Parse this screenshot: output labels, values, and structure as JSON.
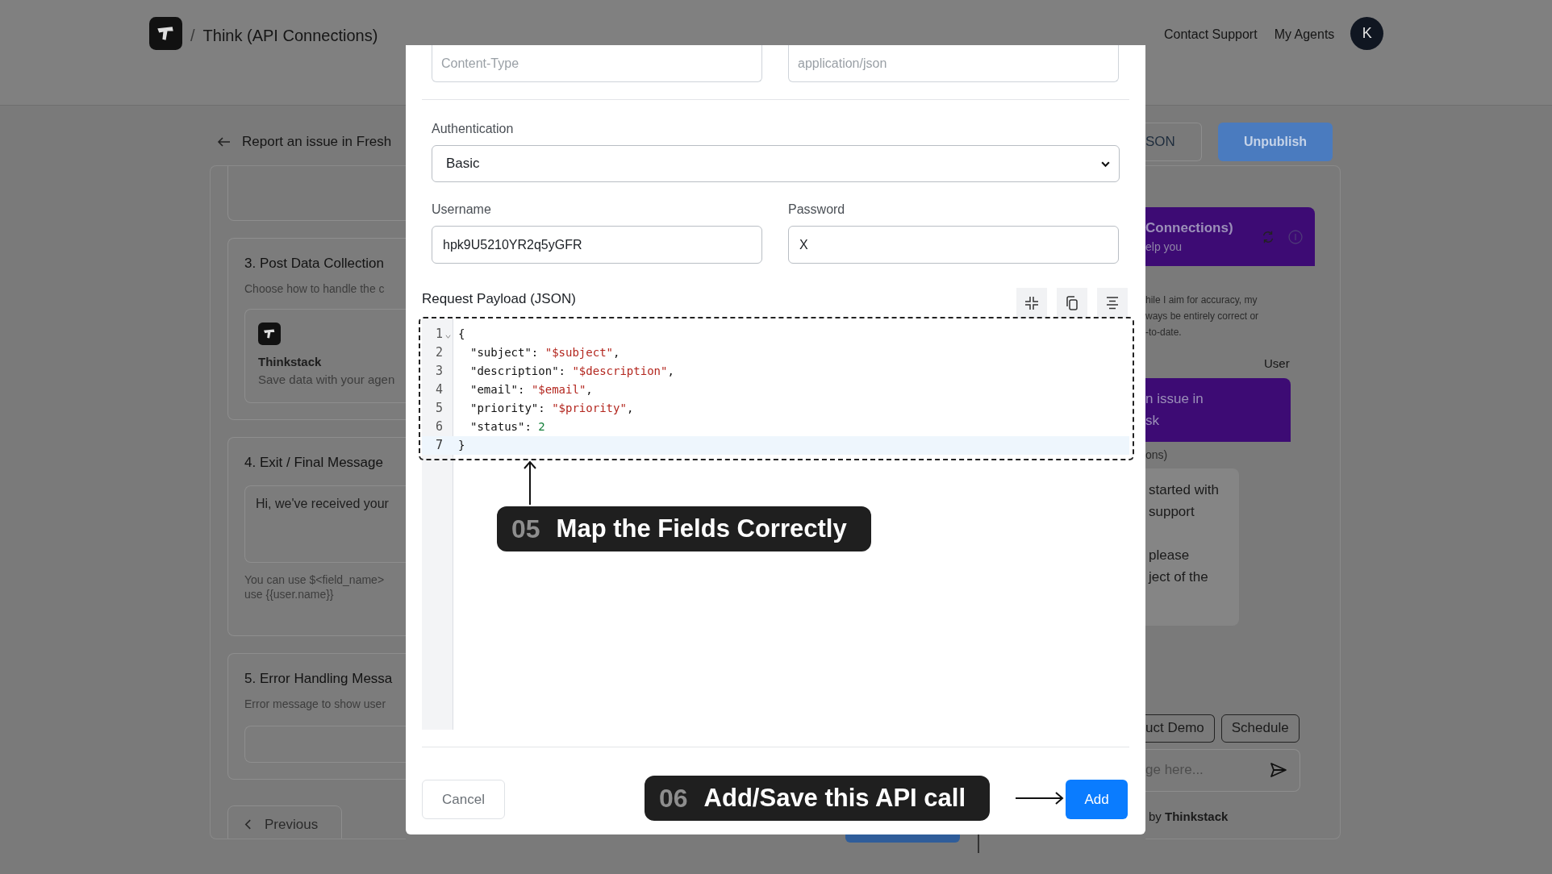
{
  "header": {
    "separator": "/",
    "title": "Think (API Connections)",
    "links": [
      "Contact Support",
      "My Agents"
    ],
    "avatar": "K"
  },
  "page": {
    "back_title": "Report an issue in Fresh",
    "buttons": [
      "SON",
      "Unpublish"
    ]
  },
  "steps": [
    {
      "kind": "options",
      "title": "3. Post Data Collection",
      "description": "Choose how to handle the c",
      "option": {
        "name": "Thinkstack",
        "description": "Save data with your agen"
      }
    },
    {
      "kind": "textarea",
      "title": "4. Exit / Final Message",
      "value": "Hi, we've received your",
      "help_lines": [
        "You can use $<field_name>",
        "use {{user.name}}"
      ]
    },
    {
      "kind": "input",
      "title": "5. Error Handling Messa",
      "description": "Error message to show user"
    }
  ],
  "previous_button": "Previous",
  "chat": {
    "title": "Connections)",
    "subtitle": "elp you",
    "disclaimer_lines": [
      "hile I aim for accuracy, my",
      "ways be entirely correct or",
      "-to-date."
    ],
    "user_label": "User",
    "user_message_lines": [
      "n issue in",
      "sk"
    ],
    "bot_label": "ons)",
    "bot_paragraphs": [
      [
        "started with",
        "support"
      ],
      [
        "please",
        "ject of the"
      ]
    ],
    "chips": [
      "uct Demo",
      "Schedule"
    ],
    "input_placeholder": "ge here...",
    "footer": "by **Thinkstack**"
  },
  "modal": {
    "header_row": {
      "key_placeholder": "Content-Type",
      "value_placeholder": "application/json"
    },
    "auth": {
      "label": "Authentication",
      "value": "Basic"
    },
    "credentials": [
      {
        "label": "Username",
        "value": "hpk9U5210YR2q5yGFR"
      },
      {
        "label": "Password",
        "value": "X"
      }
    ],
    "payload": {
      "label": "Request Payload (JSON)",
      "lines": [
        {
          "number": "1",
          "kind": "brace",
          "foldable": true,
          "highlighted": false,
          "tokens": [
            {
              "kind": "punct",
              "text": "{"
            }
          ]
        },
        {
          "number": "2",
          "kind": "member",
          "foldable": false,
          "highlighted": false,
          "tokens": [
            {
              "kind": "key",
              "text": "\"subject\""
            },
            {
              "kind": "punct",
              "text": ": "
            },
            {
              "kind": "string",
              "text": "\"$subject\""
            },
            {
              "kind": "punct",
              "text": ","
            }
          ]
        },
        {
          "number": "3",
          "kind": "member",
          "foldable": false,
          "highlighted": false,
          "tokens": [
            {
              "kind": "key",
              "text": "\"description\""
            },
            {
              "kind": "punct",
              "text": ": "
            },
            {
              "kind": "string",
              "text": "\"$description\""
            },
            {
              "kind": "punct",
              "text": ","
            }
          ]
        },
        {
          "number": "4",
          "kind": "member",
          "foldable": false,
          "highlighted": false,
          "tokens": [
            {
              "kind": "key",
              "text": "\"email\""
            },
            {
              "kind": "punct",
              "text": ": "
            },
            {
              "kind": "string",
              "text": "\"$email\""
            },
            {
              "kind": "punct",
              "text": ","
            }
          ]
        },
        {
          "number": "5",
          "kind": "member",
          "foldable": false,
          "highlighted": false,
          "tokens": [
            {
              "kind": "key",
              "text": "\"priority\""
            },
            {
              "kind": "punct",
              "text": ": "
            },
            {
              "kind": "string",
              "text": "\"$priority\""
            },
            {
              "kind": "punct",
              "text": ","
            }
          ]
        },
        {
          "number": "6",
          "kind": "member",
          "foldable": false,
          "highlighted": false,
          "tokens": [
            {
              "kind": "key",
              "text": "\"status\""
            },
            {
              "kind": "punct",
              "text": ": "
            },
            {
              "kind": "number",
              "text": "2"
            }
          ]
        },
        {
          "number": "7",
          "kind": "brace",
          "foldable": false,
          "highlighted": true,
          "tokens": [
            {
              "kind": "punct",
              "text": "}"
            }
          ]
        }
      ]
    },
    "buttons": {
      "cancel": "Cancel",
      "add": "Add"
    }
  },
  "annotations": [
    {
      "number": "05",
      "text": "Map the Fields Correctly"
    },
    {
      "number": "06",
      "text": "Add/Save this API call"
    }
  ]
}
